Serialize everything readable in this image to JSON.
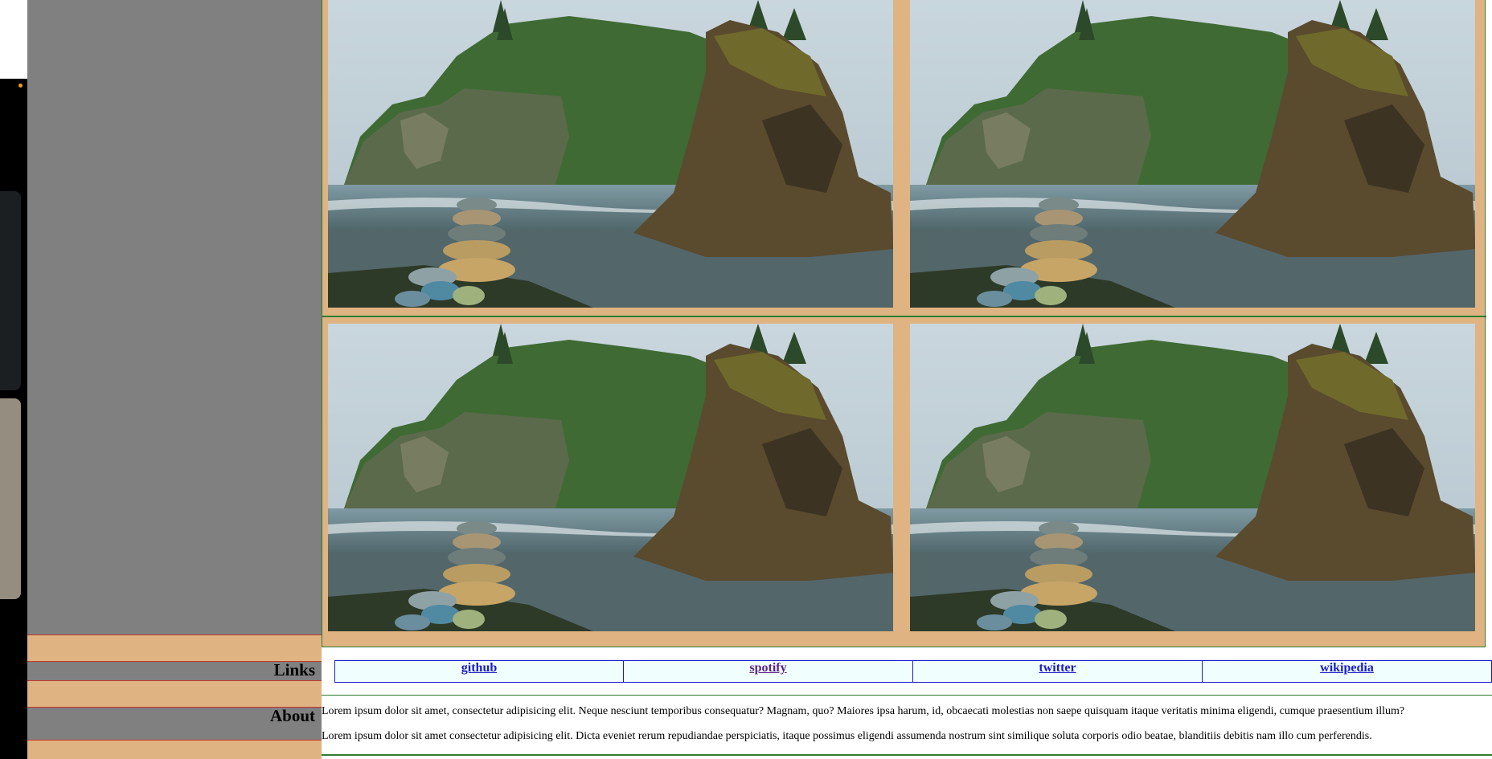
{
  "sidebar": {
    "headings": {
      "links": "Links",
      "about": "About"
    },
    "colors": {
      "background": "#808080",
      "band": "#dfb482",
      "band_border": "#c0392b"
    }
  },
  "gallery": {
    "images": [
      {
        "alt": "sea stack beach with stacked stones"
      },
      {
        "alt": "sea stack beach with stacked stones"
      },
      {
        "alt": "sea stack beach with stacked stones"
      },
      {
        "alt": "sea stack beach with stacked stones"
      }
    ],
    "colors": {
      "background": "#dfb482",
      "border": "#2e7d32"
    }
  },
  "links": [
    {
      "label": "github",
      "visited": false
    },
    {
      "label": "spotify",
      "visited": true
    },
    {
      "label": "twitter",
      "visited": false
    },
    {
      "label": "wikipedia",
      "visited": false
    }
  ],
  "about": {
    "paragraphs": [
      "Lorem ipsum dolor sit amet, consectetur adipisicing elit. Neque nesciunt temporibus consequatur? Magnam, quo? Maiores ipsa harum, id, obcaecati molestias non saepe quisquam itaque veritatis minima eligendi, cumque praesentium illum?",
      "Lorem ipsum dolor sit amet consectetur adipisicing elit. Dicta eveniet rerum repudiandae perspiciatis, itaque possimus eligendi assumenda nostrum sint similique soluta corporis odio beatae, blanditiis debitis nam illo cum perferendis."
    ]
  }
}
